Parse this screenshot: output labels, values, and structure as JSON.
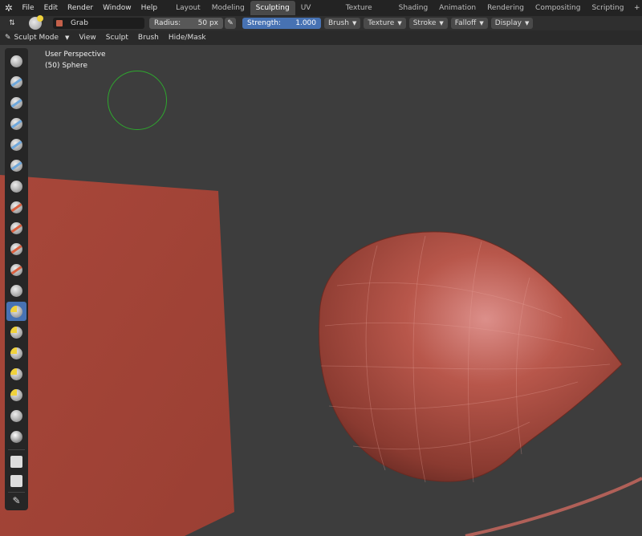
{
  "topbar": {
    "menus": [
      "File",
      "Edit",
      "Render",
      "Window",
      "Help"
    ],
    "workspaces": [
      "Layout",
      "Modeling",
      "Sculpting",
      "UV Editing",
      "Texture Paint",
      "Shading",
      "Animation",
      "Rendering",
      "Compositing",
      "Scripting"
    ],
    "active_workspace": "Sculpting",
    "add_symbol": "+"
  },
  "tool_header": {
    "brush_name": "Grab",
    "radius_label": "Radius:",
    "radius_value": "50 px",
    "strength_label": "Strength:",
    "strength_value": "1.000",
    "dropdowns": [
      "Brush",
      "Texture",
      "Stroke",
      "Falloff",
      "Display"
    ]
  },
  "mode_bar": {
    "mode": "Sculpt Mode",
    "menus": [
      "View",
      "Sculpt",
      "Brush",
      "Hide/Mask"
    ]
  },
  "viewport": {
    "view_name": "User Perspective",
    "object_info": "(50) Sphere",
    "brush_circle_color": "#2ea82e",
    "mesh_color": "#b5574a"
  },
  "toolbar": {
    "active_index": 12,
    "icons": [
      "draw-icon",
      "clay-icon",
      "clay-strips-icon",
      "layer-icon",
      "inflate-icon",
      "blob-icon",
      "crease-icon",
      "smooth-icon",
      "flatten-icon",
      "fill-icon",
      "scrape-icon",
      "pinch-icon",
      "grab-icon",
      "snake-hook-icon",
      "thumb-icon",
      "nudge-icon",
      "rotate-icon",
      "simplify-icon",
      "mask-icon",
      "box-mask-icon",
      "box-hide-icon",
      "annotate-icon"
    ]
  }
}
